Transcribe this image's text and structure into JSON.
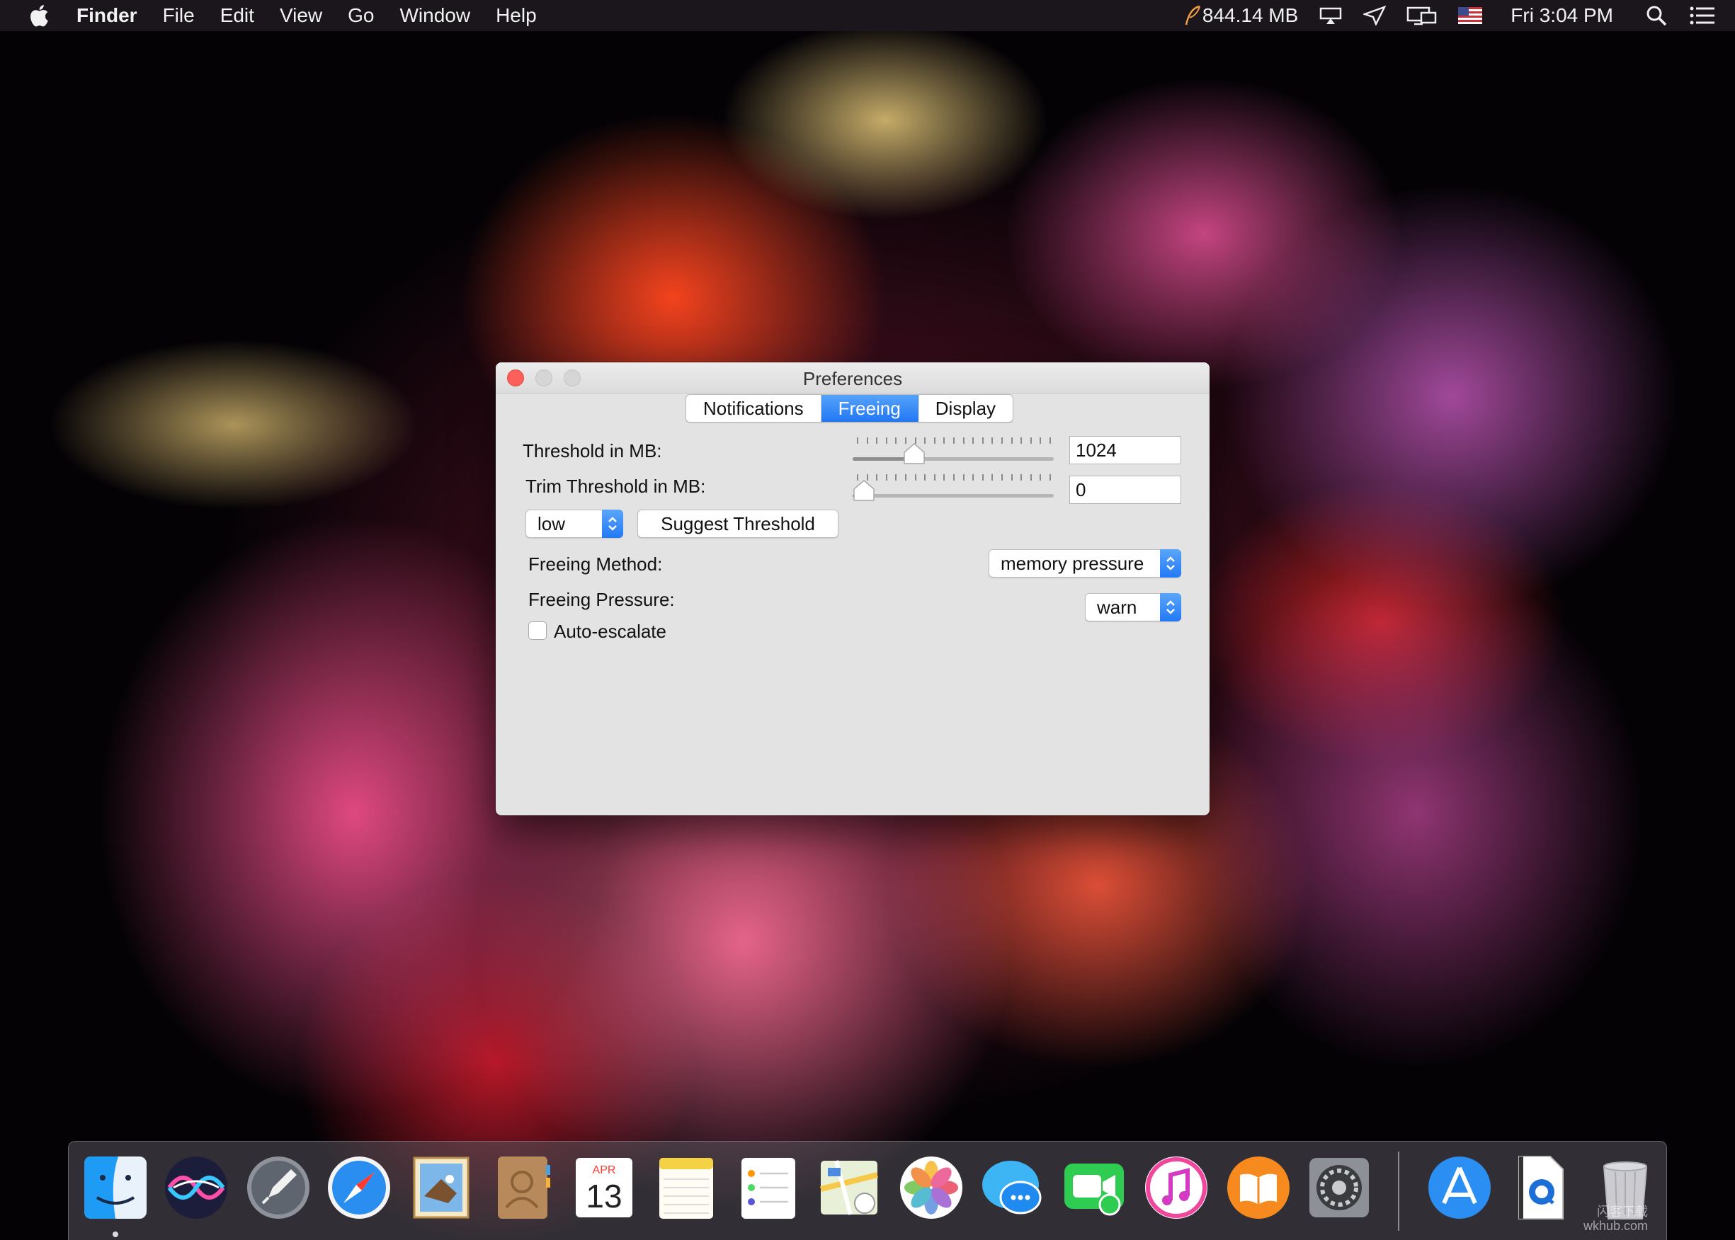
{
  "menubar": {
    "app_name": "Finder",
    "menus": [
      "File",
      "Edit",
      "View",
      "Go",
      "Window",
      "Help"
    ],
    "memory": "844.14 MB",
    "clock": "Fri 3:04 PM"
  },
  "window": {
    "title": "Preferences",
    "tabs": [
      {
        "label": "Notifications",
        "active": false
      },
      {
        "label": "Freeing",
        "active": true
      },
      {
        "label": "Display",
        "active": false
      }
    ],
    "threshold": {
      "label": "Threshold in MB:",
      "value": "1024",
      "slider_fraction": 0.28
    },
    "trim_threshold": {
      "label": "Trim Threshold in MB:",
      "value": "0",
      "slider_fraction": 0.0
    },
    "level_popup": {
      "value": "low"
    },
    "suggest_button": "Suggest Threshold",
    "freeing_method": {
      "label": "Freeing Method:",
      "value": "memory pressure"
    },
    "freeing_pressure": {
      "label": "Freeing Pressure:",
      "value": "warn"
    },
    "auto_escalate": {
      "label": "Auto-escalate",
      "checked": false
    }
  },
  "dock": {
    "apps": [
      "Finder",
      "Siri",
      "Launchpad",
      "Safari",
      "Mail",
      "Contacts",
      "Calendar",
      "Notes",
      "Reminders",
      "Maps",
      "Photos",
      "Messages",
      "FaceTime",
      "iTunes",
      "iBooks",
      "System Preferences",
      "App Store",
      "QuickTime Preview",
      "Trash"
    ],
    "calendar_month": "APR",
    "calendar_day": "13"
  },
  "watermark": {
    "line1": "闪客下载",
    "line2": "wkhub.com"
  },
  "colors": {
    "accent": "#2a7cf6",
    "close": "#fc605b",
    "window_bg": "#e3e3e3"
  }
}
